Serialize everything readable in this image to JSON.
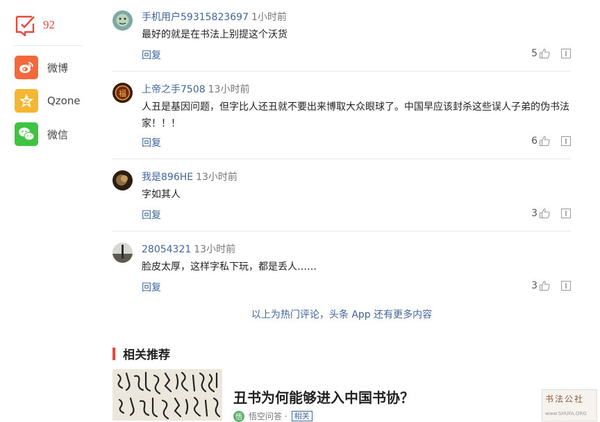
{
  "sidebar": {
    "comment_count": "92",
    "share": [
      {
        "label": "微博",
        "icon": "weibo-icon",
        "color": "#f4693b"
      },
      {
        "label": "Qzone",
        "icon": "qzone-icon",
        "color": "#f5b631"
      },
      {
        "label": "微信",
        "icon": "wechat-icon",
        "color": "#3ec441"
      }
    ]
  },
  "comments": [
    {
      "user": "手机用户59315823697",
      "time": "1小时前",
      "text": "最好的就是在书法上别提这个沃货",
      "reply": "回复",
      "likes": "5"
    },
    {
      "user": "上帝之手7508",
      "time": "13小时前",
      "text": "人丑是基因问题，但字比人还丑就不要出来博取大众眼球了。中国早应该封杀这些误人子弟的伪书法家！！！",
      "reply": "回复",
      "likes": "6"
    },
    {
      "user": "我是896HE",
      "time": "13小时前",
      "text": "字如其人",
      "reply": "回复",
      "likes": "3"
    },
    {
      "user": "28054321",
      "time": "13小时前",
      "text": "脸皮太厚，这样字私下玩，都是丢人……",
      "reply": "回复",
      "likes": "3"
    }
  ],
  "more_link": "以上为热门评论，头条 App 还有更多内容",
  "related": {
    "section_title": "相关推荐",
    "headline": "丑书为何能够进入中国书协？",
    "source_icon": "悟",
    "source": "悟空问答 ·",
    "tag": "相关"
  },
  "watermark": {
    "text": "书法公社",
    "sub": "www.SHUFA.ORG"
  },
  "colors": {
    "accent": "#e8483c",
    "link": "#406599"
  }
}
